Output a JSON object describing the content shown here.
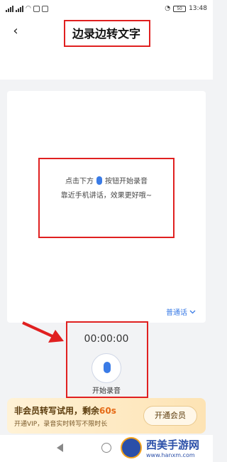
{
  "status_bar": {
    "time": "13:48",
    "battery": "50"
  },
  "nav": {
    "back_glyph": "‹",
    "title": "边录边转文字"
  },
  "card": {
    "hint_line1_pre": "点击下方",
    "hint_line1_post": "按钮开始录音",
    "hint_line2": "靠近手机讲话，效果更好哦~",
    "language": "普通话"
  },
  "recorder": {
    "timer": "00:00:00",
    "label": "开始录音"
  },
  "vip": {
    "title": "非会员转写试用，剩余",
    "remain": "60s",
    "subtitle": "开通VIP，录音实时转写不限时长",
    "button": "开通会员"
  },
  "watermark": {
    "name": "西美手游网",
    "url": "www.hanxm.com"
  },
  "colors": {
    "accent": "#3a7be6",
    "annotation": "#e02020",
    "vip_highlight": "#e56a16"
  }
}
